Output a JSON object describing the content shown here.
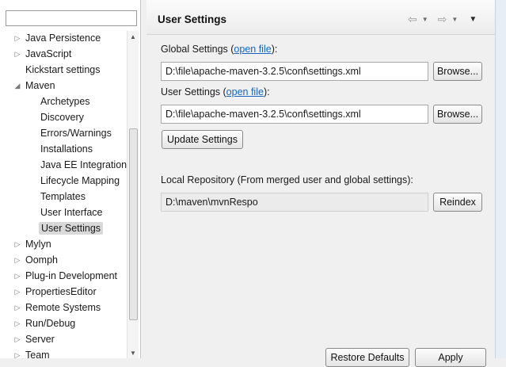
{
  "filter": {
    "value": "",
    "placeholder": ""
  },
  "tree": [
    {
      "label": "Java Persistence",
      "level": 0,
      "twisty": "collapsed"
    },
    {
      "label": "JavaScript",
      "level": 0,
      "twisty": "collapsed"
    },
    {
      "label": "Kickstart settings",
      "level": 0,
      "twisty": "none"
    },
    {
      "label": "Maven",
      "level": 0,
      "twisty": "expanded"
    },
    {
      "label": "Archetypes",
      "level": 1,
      "twisty": "none"
    },
    {
      "label": "Discovery",
      "level": 1,
      "twisty": "none"
    },
    {
      "label": "Errors/Warnings",
      "level": 1,
      "twisty": "none"
    },
    {
      "label": "Installations",
      "level": 1,
      "twisty": "none"
    },
    {
      "label": "Java EE Integration",
      "level": 1,
      "twisty": "none"
    },
    {
      "label": "Lifecycle Mapping",
      "level": 1,
      "twisty": "none"
    },
    {
      "label": "Templates",
      "level": 1,
      "twisty": "none"
    },
    {
      "label": "User Interface",
      "level": 1,
      "twisty": "none"
    },
    {
      "label": "User Settings",
      "level": 1,
      "twisty": "none",
      "selected": true
    },
    {
      "label": "Mylyn",
      "level": 0,
      "twisty": "collapsed"
    },
    {
      "label": "Oomph",
      "level": 0,
      "twisty": "collapsed"
    },
    {
      "label": "Plug-in Development",
      "level": 0,
      "twisty": "collapsed"
    },
    {
      "label": "PropertiesEditor",
      "level": 0,
      "twisty": "collapsed"
    },
    {
      "label": "Remote Systems",
      "level": 0,
      "twisty": "collapsed"
    },
    {
      "label": "Run/Debug",
      "level": 0,
      "twisty": "collapsed"
    },
    {
      "label": "Server",
      "level": 0,
      "twisty": "collapsed"
    },
    {
      "label": "Team",
      "level": 0,
      "twisty": "collapsed"
    }
  ],
  "page": {
    "title": "User Settings",
    "icons": {
      "back": "back-arrow-icon",
      "forward": "forward-arrow-icon",
      "menu": "view-menu-icon"
    },
    "global_settings": {
      "label_before": "Global Settings (",
      "link": "open file",
      "label_after": "):",
      "value": "D:\\file\\apache-maven-3.2.5\\conf\\settings.xml",
      "browse": "Browse..."
    },
    "user_settings": {
      "label_before": "User Settings (",
      "link": "open file",
      "label_after": "):",
      "value": "D:\\file\\apache-maven-3.2.5\\conf\\settings.xml",
      "browse": "Browse..."
    },
    "update_button": "Update Settings",
    "local_repo": {
      "label": "Local Repository (From merged user and global settings):",
      "value": "D:\\maven\\mvnRespo",
      "reindex": "Reindex"
    },
    "restore_defaults": "Restore Defaults",
    "apply": "Apply"
  }
}
